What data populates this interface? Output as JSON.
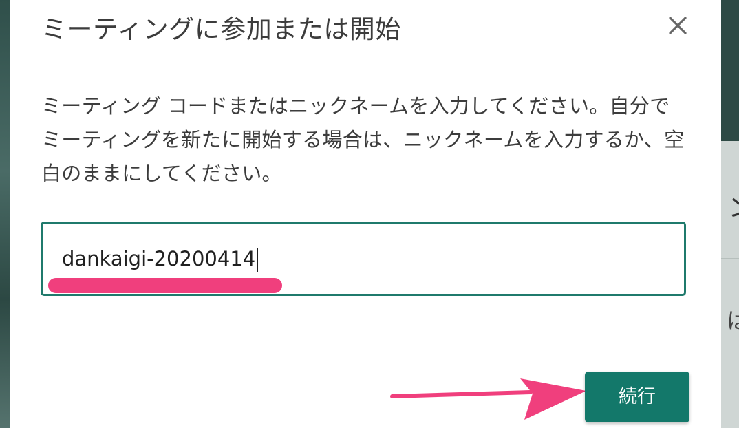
{
  "dialog": {
    "title": "ミーティングに参加または開始",
    "description": "ミーティング コードまたはニックネームを入力してください。自分でミーティングを新たに開始する場合は、ニックネームを入力するか、空白のままにしてください。",
    "input_value": "dankaigi-20200414",
    "continue_label": "続行"
  },
  "background": {
    "peek_text_1": "ン",
    "peek_text_2": "は"
  },
  "colors": {
    "accent": "#13786a",
    "highlight": "#f03f7d"
  },
  "icons": {
    "close": "close-icon"
  }
}
